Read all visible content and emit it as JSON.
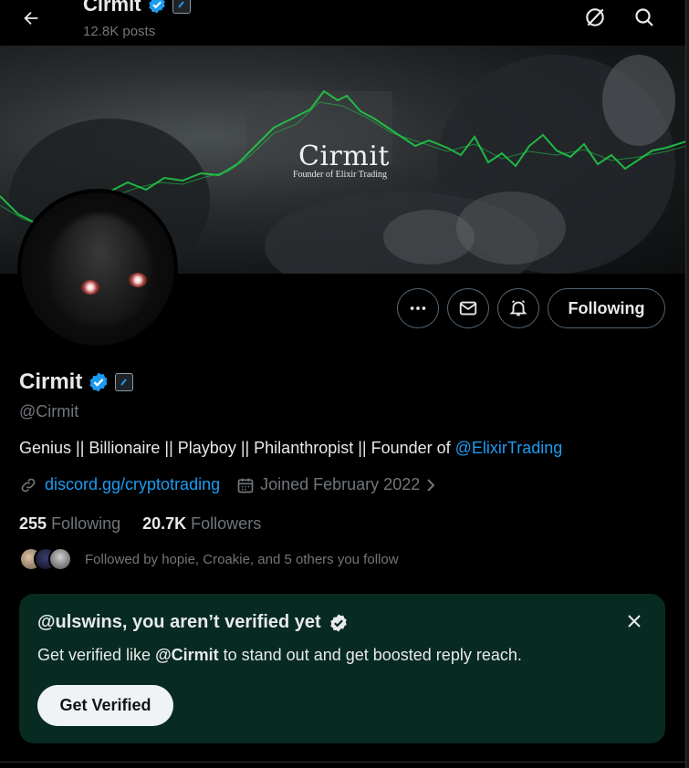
{
  "header": {
    "name": "Cirmit",
    "posts": "12.8K posts"
  },
  "banner": {
    "title": "Cirmit",
    "subtitle": "Founder of Elixir Trading"
  },
  "actions": {
    "follow_label": "Following"
  },
  "profile": {
    "name": "Cirmit",
    "handle": "@Cirmit",
    "bio_text": "Genius || Billionaire || Playboy || Philanthropist || Founder of ",
    "bio_mention": "@ElixirTrading",
    "link": "discord.gg/cryptotrading",
    "joined": "Joined February 2022",
    "following_count": "255",
    "following_label": "Following",
    "followers_count": "20.7K",
    "followers_label": "Followers",
    "followed_by": "Followed by hopie, Croakie, and 5 others you follow"
  },
  "verify_card": {
    "title": "@ulswins, you aren’t verified yet",
    "text_before": "Get verified like ",
    "text_handle": "@Cirmit",
    "text_after": " to stand out and get boosted reply reach.",
    "button": "Get Verified"
  },
  "colors": {
    "background": "#000000",
    "accent": "#1d9bf0",
    "muted": "#71767b",
    "card_bg": "#072a21",
    "chart_green": "#1fd14a"
  },
  "icons": [
    "back-arrow-icon",
    "verified-badge-icon",
    "affiliate-badge-icon",
    "grok-icon",
    "search-icon",
    "more-icon",
    "message-icon",
    "notification-bell-icon",
    "link-icon",
    "calendar-icon",
    "chevron-right-icon",
    "close-icon"
  ]
}
